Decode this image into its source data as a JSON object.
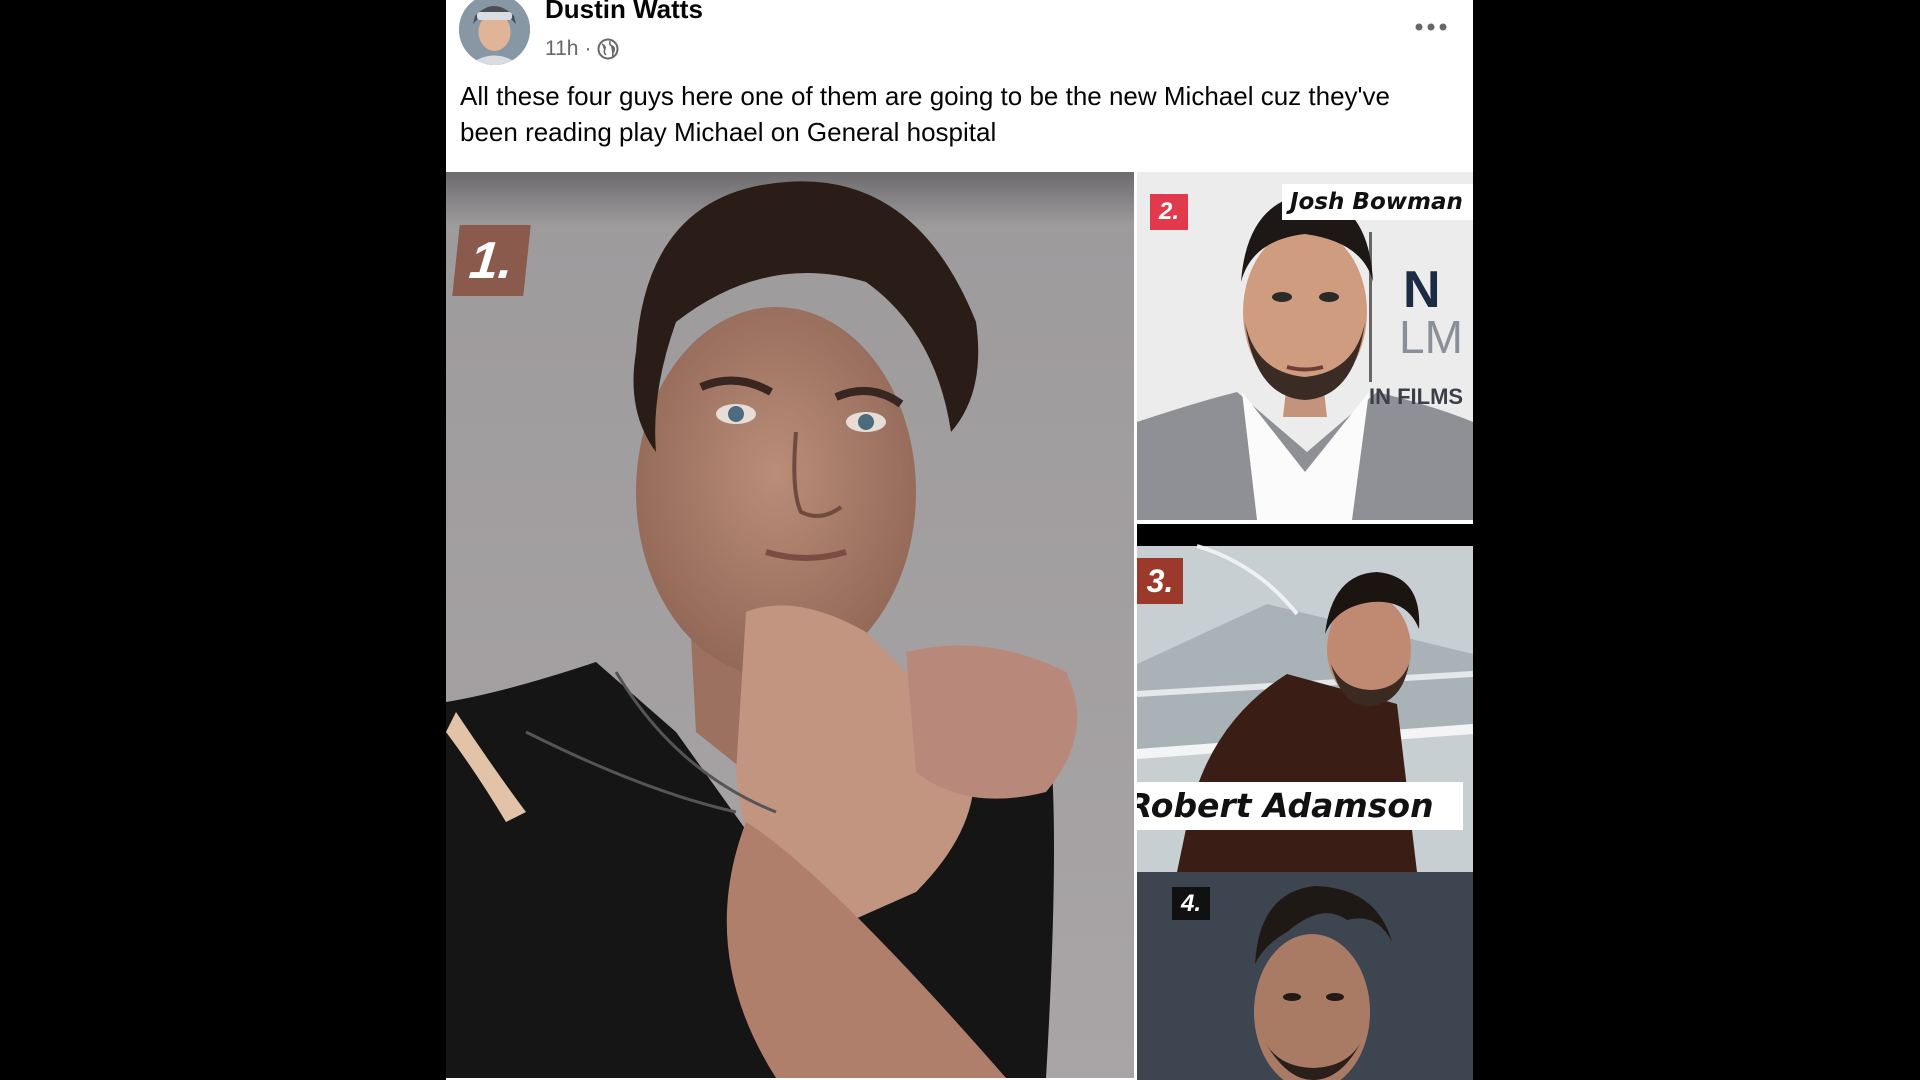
{
  "post": {
    "author": "Dustin Watts",
    "timestamp": "11h",
    "separator": "·",
    "privacy_icon": "globe-icon",
    "more_icon": "more-options-icon",
    "text": "All these four guys here one of them are going to be the new Michael cuz they've been reading play Michael on General hospital"
  },
  "photos": [
    {
      "badge": "1."
    },
    {
      "badge": "2.",
      "name": "Josh Bowman",
      "backdrop_letters": {
        "n": "N",
        "lm": "LM",
        "in_films": "IN FILMS"
      }
    },
    {
      "badge": "3.",
      "name": "Robert Adamson"
    },
    {
      "badge": "4."
    }
  ],
  "colors": {
    "page_background": "#000000",
    "card_background": "#ffffff",
    "text_primary": "#050505",
    "text_secondary": "#65676b",
    "badge_1": "#8a5a4c",
    "badge_2": "#e03a4c",
    "badge_3": "#9b3a2a",
    "badge_4": "#111111"
  }
}
